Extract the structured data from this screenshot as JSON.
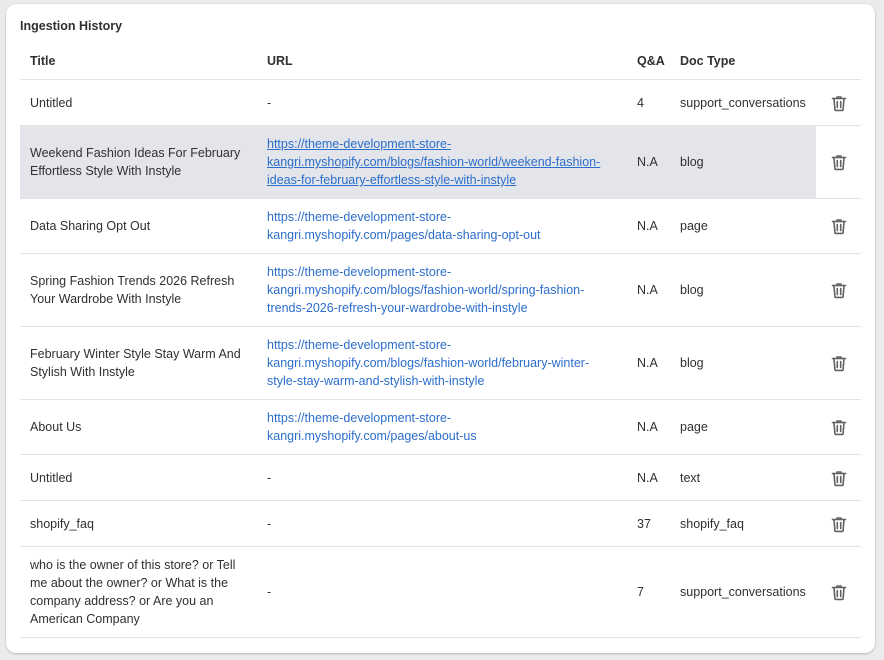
{
  "card": {
    "title": "Ingestion History"
  },
  "columns": {
    "title": "Title",
    "url": "URL",
    "qa": "Q&A",
    "doc_type": "Doc Type"
  },
  "delete_icon": "trash-icon",
  "colors": {
    "link": "#2c6ecb",
    "highlight_row": "#e3e5ea",
    "icon": "#616161"
  },
  "rows": [
    {
      "title": "Untitled",
      "url": "-",
      "qa": "4",
      "doc_type": "support_conversations"
    },
    {
      "title": "Weekend Fashion Ideas For February Effortless Style With Instyle",
      "url": "https://theme-development-store-kangri.myshopify.com/blogs/fashion-world/weekend-fashion-ideas-for-february-effortless-style-with-instyle",
      "qa": "N.A",
      "doc_type": "blog"
    },
    {
      "title": "Data Sharing Opt Out",
      "url": "https://theme-development-store-kangri.myshopify.com/pages/data-sharing-opt-out",
      "qa": "N.A",
      "doc_type": "page"
    },
    {
      "title": "Spring Fashion Trends 2026 Refresh Your Wardrobe With Instyle",
      "url": "https://theme-development-store-kangri.myshopify.com/blogs/fashion-world/spring-fashion-trends-2026-refresh-your-wardrobe-with-instyle",
      "qa": "N.A",
      "doc_type": "blog"
    },
    {
      "title": "February Winter Style Stay Warm And Stylish With Instyle",
      "url": "https://theme-development-store-kangri.myshopify.com/blogs/fashion-world/february-winter-style-stay-warm-and-stylish-with-instyle",
      "qa": "N.A",
      "doc_type": "blog"
    },
    {
      "title": "About Us",
      "url": "https://theme-development-store-kangri.myshopify.com/pages/about-us",
      "qa": "N.A",
      "doc_type": "page"
    },
    {
      "title": "Untitled",
      "url": "-",
      "qa": "N.A",
      "doc_type": "text"
    },
    {
      "title": "shopify_faq",
      "url": "-",
      "qa": "37",
      "doc_type": "shopify_faq"
    },
    {
      "title": "who is the owner of this store? or Tell me about the owner? or What is the company address? or Are you an American Company",
      "url": "-",
      "qa": "7",
      "doc_type": "support_conversations"
    }
  ]
}
